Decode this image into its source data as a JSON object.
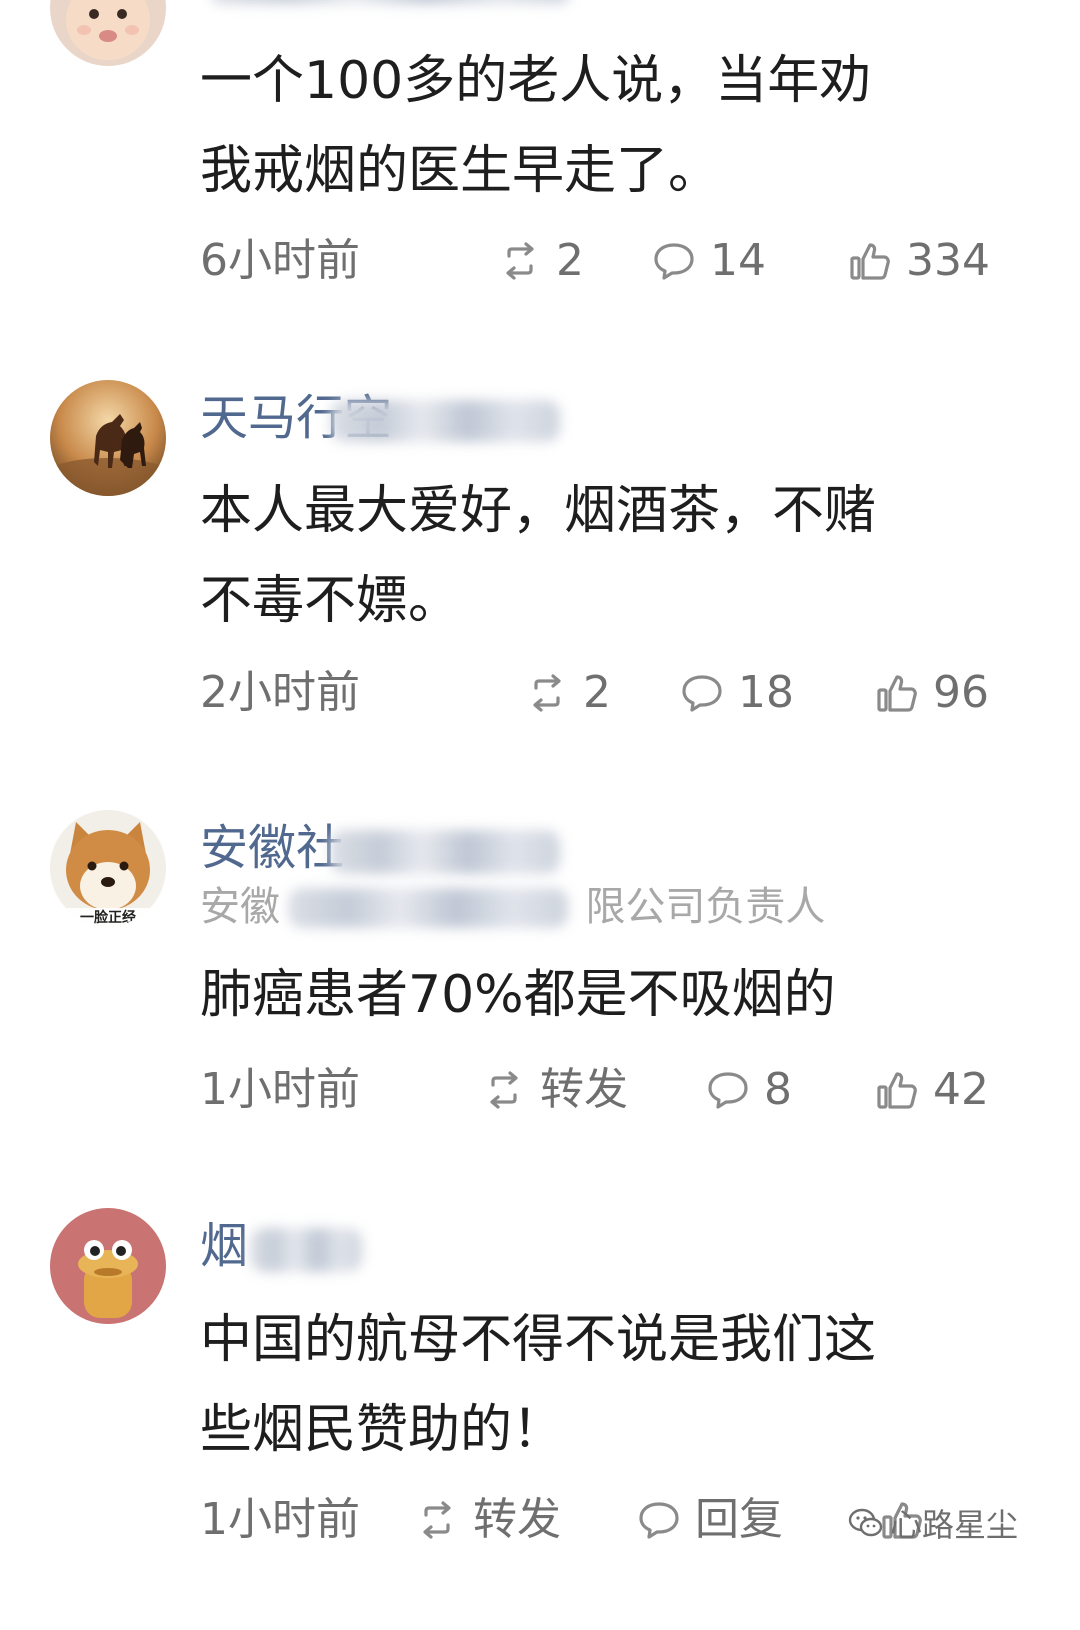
{
  "comments": [
    {
      "username": "",
      "text_lines": [
        "一个100多的老人说，当年劝",
        "我戒烟的医生早走了。"
      ],
      "time": "6小时前",
      "repost": "2",
      "reply": "14",
      "like": "334"
    },
    {
      "username": "天马行空",
      "text_lines": [
        "本人最大爱好，烟酒茶，不赌",
        "不毒不嫖。"
      ],
      "time": "2小时前",
      "repost": "2",
      "reply": "18",
      "like": "96"
    },
    {
      "username": "安徽社",
      "subtitle_start": "安徽",
      "subtitle_end": "限公司负责人",
      "avatar_caption": "一脸正经",
      "text_lines": [
        "肺癌患者70%都是不吸烟的"
      ],
      "time": "1小时前",
      "repost": "转发",
      "reply": "8",
      "like": "42"
    },
    {
      "username": "烟",
      "text_lines": [
        "中国的航母不得不说是我们这",
        "些烟民赞助的！"
      ],
      "time": "1小时前",
      "repost": "转发",
      "reply": "回复",
      "like": ""
    }
  ],
  "watermark": {
    "text": "心路星尘",
    "icon": "wechat-icon"
  },
  "colors": {
    "username": "#51688f",
    "body_text": "#1e1e1e",
    "meta_text": "#6f6f6f",
    "subtitle": "#a8a8a8"
  },
  "icons": {
    "repost": "repost-icon",
    "reply": "comment-bubble-icon",
    "like": "thumbs-up-icon"
  }
}
